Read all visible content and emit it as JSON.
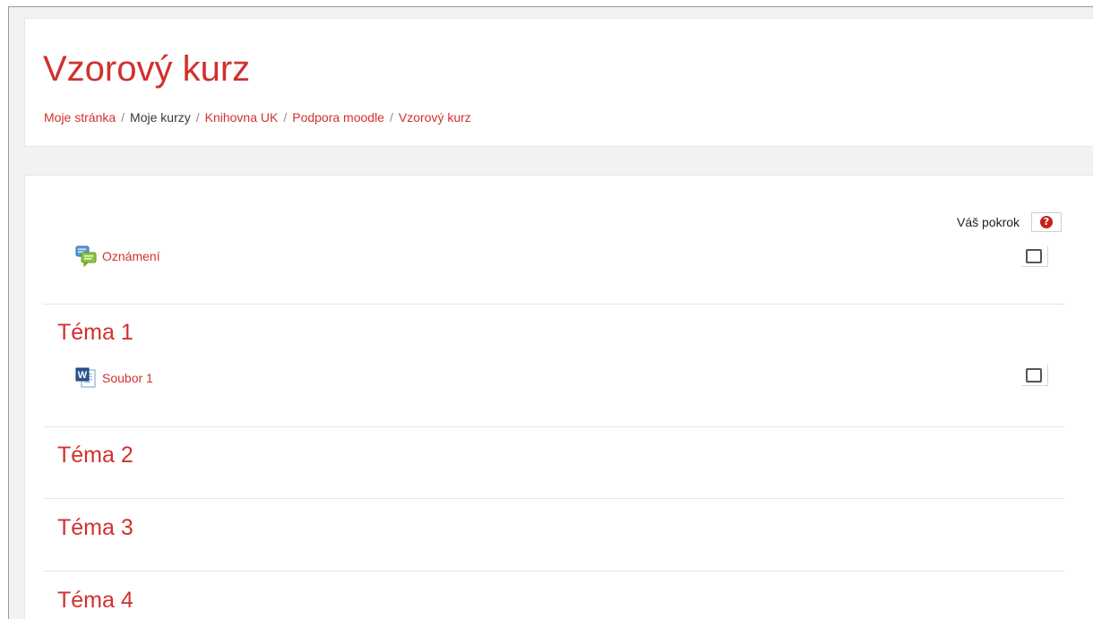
{
  "course": {
    "title": "Vzorový kurz"
  },
  "breadcrumb": {
    "items": [
      {
        "label": "Moje stránka",
        "link": true
      },
      {
        "label": "Moje kurzy",
        "link": false
      },
      {
        "label": "Knihovna UK",
        "link": true
      },
      {
        "label": "Podpora moodle",
        "link": true
      },
      {
        "label": "Vzorový kurz",
        "link": true
      }
    ],
    "separator": "/"
  },
  "progress": {
    "label": "Váš pokrok",
    "help_glyph": "?"
  },
  "general_section": {
    "activities": [
      {
        "name": "Oznámení",
        "icon": "forum-icon",
        "completed": false
      }
    ]
  },
  "sections": [
    {
      "title": "Téma 1",
      "activities": [
        {
          "name": "Soubor 1",
          "icon": "word-document-icon",
          "completed": false
        }
      ]
    },
    {
      "title": "Téma 2",
      "activities": []
    },
    {
      "title": "Téma 3",
      "activities": []
    },
    {
      "title": "Téma 4",
      "activities": []
    }
  ],
  "colors": {
    "accent": "#d0312d",
    "help": "#c7211a"
  }
}
